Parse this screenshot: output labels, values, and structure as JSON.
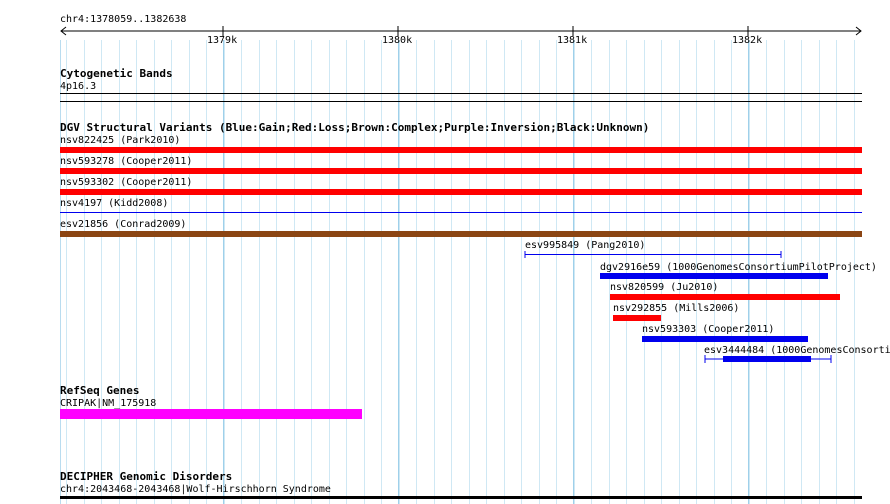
{
  "ruler": {
    "region": "chr4:1378059..1382638",
    "ticks": [
      "1379k",
      "1380k",
      "1381k",
      "1382k"
    ]
  },
  "tracks": {
    "cyto": {
      "title": "Cytogenetic Bands",
      "band": "4p16.3"
    },
    "dgv": {
      "title": "DGV Structural Variants (Blue:Gain;Red:Loss;Brown:Complex;Purple:Inversion;Black:Unknown)",
      "colors": {
        "gain": "#0000ee",
        "loss": "#ff0000",
        "complex": "#8b4513",
        "unknown": "#000000"
      },
      "variants": [
        {
          "label": "nsv822425 (Park2010)"
        },
        {
          "label": "nsv593278 (Cooper2011)"
        },
        {
          "label": "nsv593302 (Cooper2011)"
        },
        {
          "label": "nsv4197 (Kidd2008)"
        },
        {
          "label": "esv21856 (Conrad2009)"
        },
        {
          "label": "esv995849 (Pang2010)"
        },
        {
          "label": "dgv2916e59 (1000GenomesConsortiumPilotProject)"
        },
        {
          "label": "nsv820599 (Ju2010)"
        },
        {
          "label": "nsv292855 (Mills2006)"
        },
        {
          "label": "nsv593303 (Cooper2011)"
        },
        {
          "label": "esv3444484 (1000GenomesConsorti"
        }
      ]
    },
    "refseq": {
      "title": "RefSeq Genes",
      "gene": "CRIPAK|NM_175918",
      "color": "#ff00ff"
    },
    "decipher": {
      "title": "DECIPHER Genomic Disorders",
      "entry": "chr4:2043468-2043468|Wolf-Hirschhorn Syndrome"
    }
  }
}
